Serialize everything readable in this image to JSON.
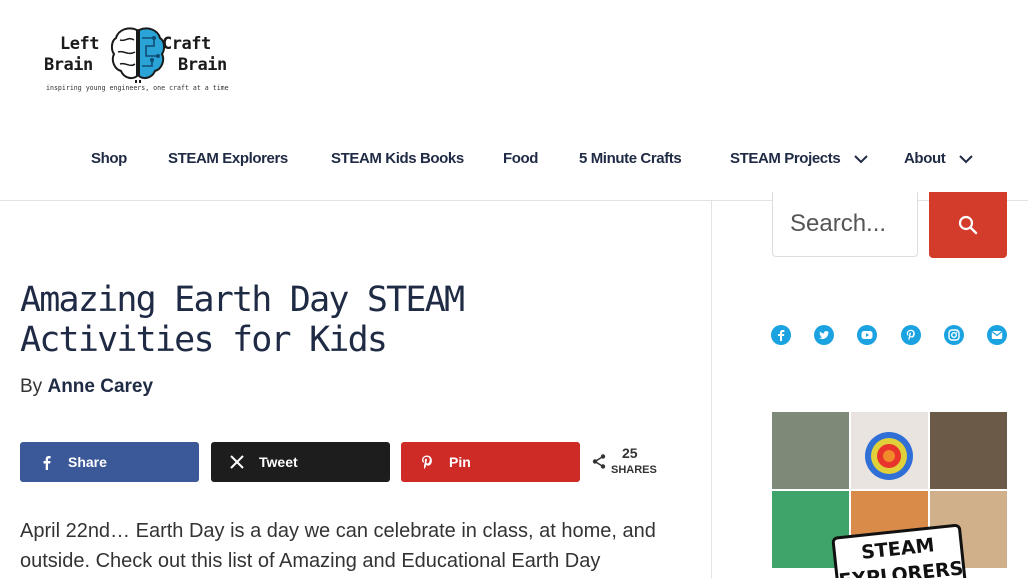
{
  "logo": {
    "word_tl": "Left",
    "word_tr": "Craft",
    "word_bl": "Brain",
    "word_br": "Brain",
    "tagline": "inspiring young engineers, one craft at a time"
  },
  "nav": {
    "items": [
      {
        "label": "Shop"
      },
      {
        "label": "STEAM Explorers"
      },
      {
        "label": "STEAM Kids Books"
      },
      {
        "label": "Food"
      },
      {
        "label": "5 Minute Crafts"
      },
      {
        "label": "STEAM Projects"
      },
      {
        "label": "About"
      }
    ],
    "dropdown_icon": "chevron-down-icon"
  },
  "search": {
    "placeholder": "Search..."
  },
  "social": [
    "facebook-icon",
    "twitter-icon",
    "youtube-icon",
    "pinterest-icon",
    "instagram-icon",
    "email-icon"
  ],
  "article": {
    "title": "Amazing Earth Day STEAM Activities for Kids",
    "byline_prefix": "By",
    "author": "Anne Carey",
    "intro": "April 22nd… Earth Day is a day we can celebrate in class, at home, and outside. Check out this list of Amazing and Educational Earth Day"
  },
  "share": {
    "facebook": "Share",
    "twitter": "Tweet",
    "pinterest": "Pin",
    "count": "25",
    "count_label": "SHARES"
  },
  "promo": {
    "label_line1": "STEAM",
    "label_line2": "EXPLORERS"
  },
  "colors": {
    "accent_red": "#d33b2b",
    "facebook": "#3b5998",
    "twitter": "#1d1d1d",
    "pinterest": "#ce2b27",
    "social_blue": "#1aa3e0",
    "nav_text": "#1f2a44"
  }
}
